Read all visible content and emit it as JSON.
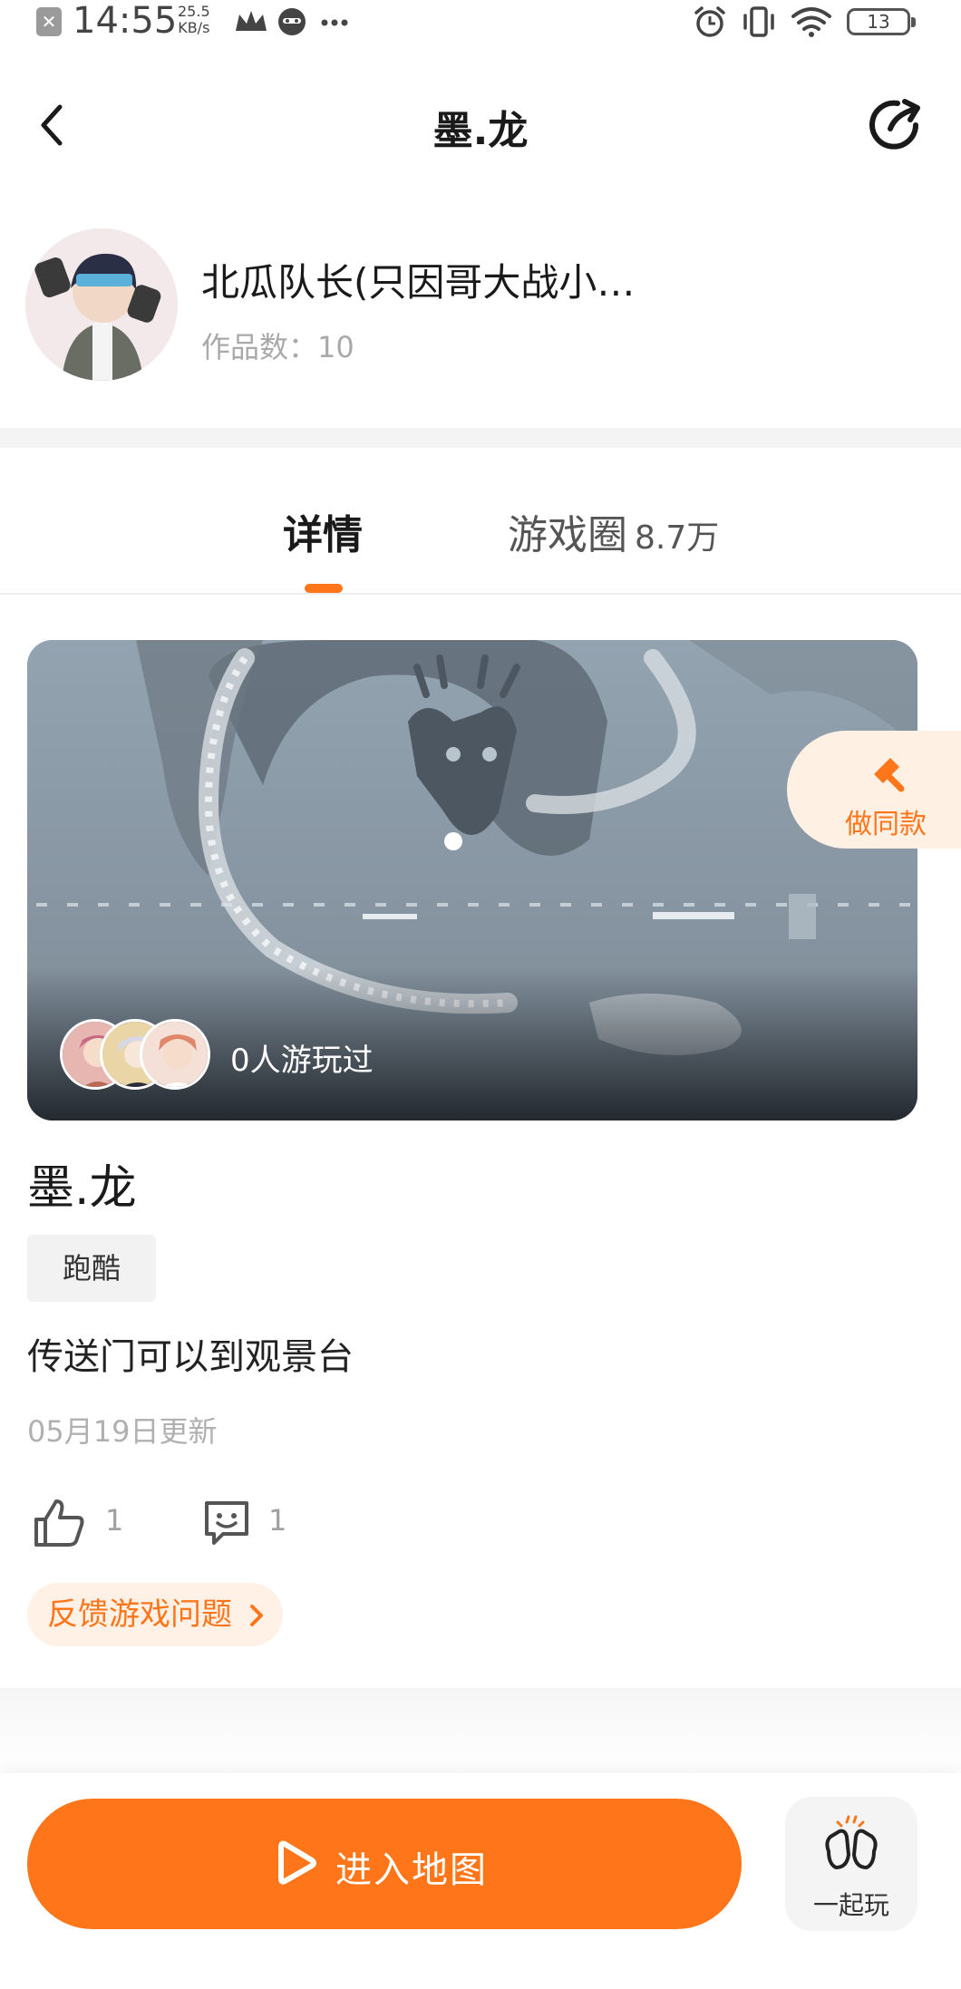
{
  "status_bar": {
    "time": "14:55",
    "speed_value": "25.5",
    "speed_unit": "KB/s",
    "battery": "13",
    "icons": [
      "notification-x-icon",
      "crown-icon",
      "cat-face-icon",
      "more-dots-icon",
      "alarm-icon",
      "vibrate-icon",
      "wifi-icon",
      "battery-icon"
    ]
  },
  "header": {
    "title": "墨.龙",
    "back_icon": "chevron-left-icon",
    "share_icon": "share-icon"
  },
  "author": {
    "name": "北瓜队长(只因哥大战小…",
    "works_label": "作品数：",
    "works_count": "10"
  },
  "tabs": [
    {
      "label": "详情",
      "active": true
    },
    {
      "label": "游戏圈",
      "count": "8.7万",
      "active": false
    }
  ],
  "banner": {
    "played_text": "0人游玩过"
  },
  "make_same": {
    "label": "做同款",
    "icon": "hammer-icon"
  },
  "game": {
    "title": "墨.龙",
    "tag": "跑酷",
    "description": "传送门可以到观景台",
    "updated": "05月19日更新",
    "likes": "1",
    "comments": "1",
    "feedback": "反馈游戏问题"
  },
  "actions": {
    "enter_label": "进入地图",
    "together_label": "一起玩"
  },
  "colors": {
    "accent": "#ff7519",
    "accent_soft": "#fff0e4",
    "muted_text": "#a9a9a9"
  }
}
